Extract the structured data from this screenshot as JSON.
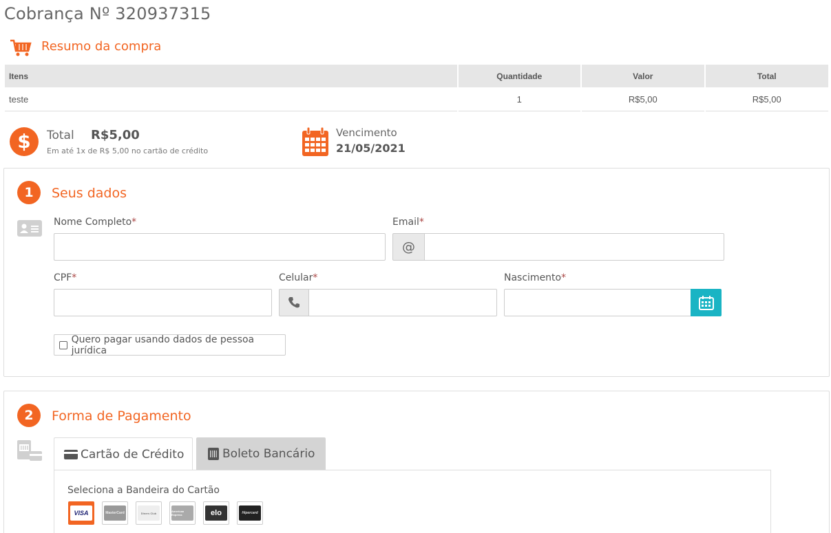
{
  "header": {
    "title": "Cobrança Nº 320937315"
  },
  "summary": {
    "title": "Resumo da compra",
    "columns": [
      "Itens",
      "Quantidade",
      "Valor",
      "Total"
    ],
    "rows": [
      {
        "item": "teste",
        "quantity": "1",
        "value": "R$5,00",
        "total": "R$5,00"
      }
    ]
  },
  "totals": {
    "total_label": "Total",
    "total_value": "R$5,00",
    "installments": "Em até 1x de R$ 5,00 no cartão de crédito",
    "due_label": "Vencimento",
    "due_date": "21/05/2021"
  },
  "step1": {
    "number": "1",
    "title": "Seus dados",
    "fields": {
      "name_label": "Nome Completo",
      "email_label": "Email",
      "email_addon": "@",
      "cpf_label": "CPF",
      "phone_label": "Celular",
      "birth_label": "Nascimento",
      "required_mark": "*"
    },
    "company_checkbox": "Quero pagar usando dados de pessoa jurídica"
  },
  "step2": {
    "number": "2",
    "title": "Forma de Pagamento",
    "tabs": [
      {
        "label": "Cartão de Crédito",
        "active": true
      },
      {
        "label": "Boleto Bancário",
        "active": false
      }
    ],
    "brand_label": "Seleciona a Bandeira do Cartão",
    "brands": [
      "VISA",
      "MasterCard",
      "Diners Club",
      "American Express",
      "elo",
      "Hipercard"
    ]
  },
  "colors": {
    "accent": "#f26522",
    "teal": "#1ab4c4",
    "required": "#a94442"
  }
}
